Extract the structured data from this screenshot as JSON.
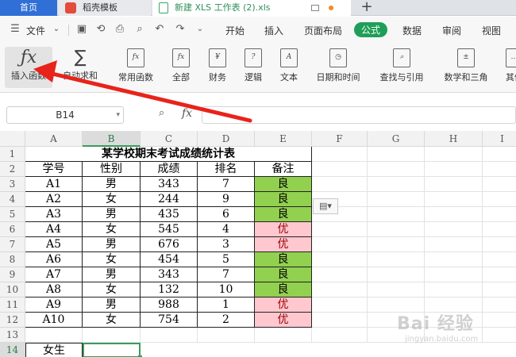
{
  "tabs": {
    "home": "首页",
    "template": "稻壳模板",
    "file": "新建 XLS 工作表 (2).xls",
    "add": "+"
  },
  "menubar": {
    "file_menu": "文件",
    "items": [
      "开始",
      "插入",
      "页面布局",
      "公式",
      "数据",
      "审阅",
      "视图"
    ],
    "active": "公式"
  },
  "ribbon": {
    "items": [
      "插入函数",
      "自动求和",
      "常用函数",
      "全部",
      "财务",
      "逻辑",
      "文本",
      "日期和时间",
      "查找与引用",
      "数学和三角",
      "其他"
    ]
  },
  "formula_bar": {
    "name_box": "B14",
    "fx": "fx",
    "value": ""
  },
  "sheet": {
    "columns": [
      "A",
      "B",
      "C",
      "D",
      "E",
      "F",
      "G",
      "H",
      "I"
    ],
    "selected_column": "B",
    "rows": [
      "1",
      "2",
      "3",
      "4",
      "5",
      "6",
      "7",
      "8",
      "9",
      "10",
      "11",
      "12",
      "13",
      "14"
    ],
    "selected_row": "14",
    "title": "某学校期末考试成绩统计表",
    "headers": [
      "学号",
      "性别",
      "成绩",
      "排名",
      "备注"
    ],
    "records": [
      [
        "A1",
        "男",
        "343",
        "7",
        "良"
      ],
      [
        "A2",
        "女",
        "244",
        "9",
        "良"
      ],
      [
        "A3",
        "男",
        "435",
        "6",
        "良"
      ],
      [
        "A4",
        "女",
        "545",
        "4",
        "优"
      ],
      [
        "A5",
        "男",
        "676",
        "3",
        "优"
      ],
      [
        "A6",
        "女",
        "454",
        "5",
        "良"
      ],
      [
        "A7",
        "男",
        "343",
        "7",
        "良"
      ],
      [
        "A8",
        "女",
        "132",
        "10",
        "良"
      ],
      [
        "A9",
        "男",
        "988",
        "1",
        "优"
      ],
      [
        "A10",
        "女",
        "754",
        "2",
        "优"
      ]
    ],
    "label_a14": "女生",
    "active_cell": "B14"
  },
  "colors": {
    "good_fill": "#92d050",
    "excellent_fill": "#ffc7ce",
    "excellent_text": "#9c0006",
    "accent": "#1f9e57",
    "arrow": "#e8231b"
  },
  "watermark": {
    "main": "Bai 经验",
    "sub": "jingyan.baidu.com"
  }
}
